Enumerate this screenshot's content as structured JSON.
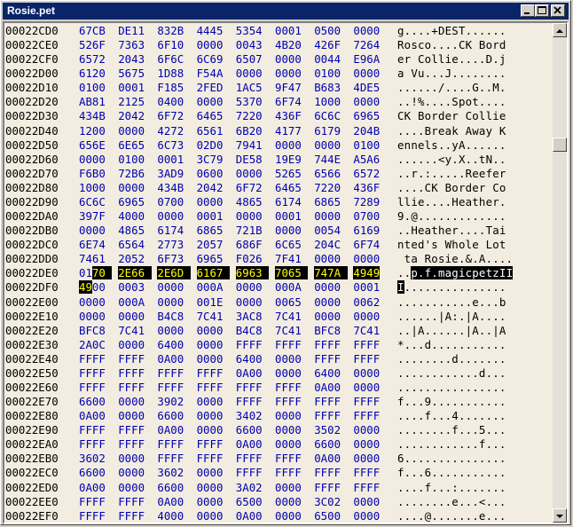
{
  "window": {
    "title": "Rosie.pet"
  },
  "rows": [
    {
      "addr": "00022CD0",
      "hex": [
        "67CB",
        "DE11",
        "832B",
        "4445",
        "5354",
        "0001",
        "0500",
        "0000"
      ],
      "ascii": "g....+DEST......"
    },
    {
      "addr": "00022CE0",
      "hex": [
        "526F",
        "7363",
        "6F10",
        "0000",
        "0043",
        "4B20",
        "426F",
        "7264"
      ],
      "ascii": "Rosco....CK Bord"
    },
    {
      "addr": "00022CF0",
      "hex": [
        "6572",
        "2043",
        "6F6C",
        "6C69",
        "6507",
        "0000",
        "0044",
        "E96A"
      ],
      "ascii": "er Collie....D.j"
    },
    {
      "addr": "00022D00",
      "hex": [
        "6120",
        "5675",
        "1D88",
        "F54A",
        "0000",
        "0000",
        "0100",
        "0000"
      ],
      "ascii": "a Vu...J........"
    },
    {
      "addr": "00022D10",
      "hex": [
        "0100",
        "0001",
        "F185",
        "2FED",
        "1AC5",
        "9F47",
        "B683",
        "4DE5"
      ],
      "ascii": "....../....G..M."
    },
    {
      "addr": "00022D20",
      "hex": [
        "AB81",
        "2125",
        "0400",
        "0000",
        "5370",
        "6F74",
        "1000",
        "0000"
      ],
      "ascii": "..!%....Spot...."
    },
    {
      "addr": "00022D30",
      "hex": [
        "434B",
        "2042",
        "6F72",
        "6465",
        "7220",
        "436F",
        "6C6C",
        "6965"
      ],
      "ascii": "CK Border Collie"
    },
    {
      "addr": "00022D40",
      "hex": [
        "1200",
        "0000",
        "4272",
        "6561",
        "6B20",
        "4177",
        "6179",
        "204B"
      ],
      "ascii": "....Break Away K"
    },
    {
      "addr": "00022D50",
      "hex": [
        "656E",
        "6E65",
        "6C73",
        "02D0",
        "7941",
        "0000",
        "0000",
        "0100"
      ],
      "ascii": "ennels..yA......"
    },
    {
      "addr": "00022D60",
      "hex": [
        "0000",
        "0100",
        "0001",
        "3C79",
        "DE58",
        "19E9",
        "744E",
        "A5A6"
      ],
      "ascii": "......<y.X..tN.."
    },
    {
      "addr": "00022D70",
      "hex": [
        "F6B0",
        "72B6",
        "3AD9",
        "0600",
        "0000",
        "5265",
        "6566",
        "6572"
      ],
      "ascii": "..r.:.....Reefer"
    },
    {
      "addr": "00022D80",
      "hex": [
        "1000",
        "0000",
        "434B",
        "2042",
        "6F72",
        "6465",
        "7220",
        "436F"
      ],
      "ascii": "....CK Border Co"
    },
    {
      "addr": "00022D90",
      "hex": [
        "6C6C",
        "6965",
        "0700",
        "0000",
        "4865",
        "6174",
        "6865",
        "7289"
      ],
      "ascii": "llie....Heather."
    },
    {
      "addr": "00022DA0",
      "hex": [
        "397F",
        "4000",
        "0000",
        "0001",
        "0000",
        "0001",
        "0000",
        "0700"
      ],
      "ascii": "9.@............."
    },
    {
      "addr": "00022DB0",
      "hex": [
        "0000",
        "4865",
        "6174",
        "6865",
        "721B",
        "0000",
        "0054",
        "6169"
      ],
      "ascii": "..Heather....Tai"
    },
    {
      "addr": "00022DC0",
      "hex": [
        "6E74",
        "6564",
        "2773",
        "2057",
        "686F",
        "6C65",
        "204C",
        "6F74"
      ],
      "ascii": "nted's Whole Lot"
    },
    {
      "addr": "00022DD0",
      "hex": [
        "7461",
        "2052",
        "6F73",
        "6965",
        "F026",
        "7F41",
        "0000",
        "0000"
      ],
      "ascii": " ta Rosie.&.A...."
    },
    {
      "addr": "00022DE0",
      "hex": [
        "0170",
        "2E66",
        "2E6D",
        "6167",
        "6963",
        "7065",
        "747A",
        "4949"
      ],
      "ascii": "..p.f.magicpetzII"
    },
    {
      "addr": "00022DF0",
      "hex": [
        "4900",
        "0003",
        "0000",
        "000A",
        "0000",
        "000A",
        "0000",
        "0001"
      ],
      "ascii": "I..............."
    },
    {
      "addr": "00022E00",
      "hex": [
        "0000",
        "000A",
        "0000",
        "001E",
        "0000",
        "0065",
        "0000",
        "0062"
      ],
      "ascii": "...........e...b"
    },
    {
      "addr": "00022E10",
      "hex": [
        "0000",
        "0000",
        "B4C8",
        "7C41",
        "3AC8",
        "7C41",
        "0000",
        "0000"
      ],
      "ascii": "......|A:.|A...."
    },
    {
      "addr": "00022E20",
      "hex": [
        "BFC8",
        "7C41",
        "0000",
        "0000",
        "B4C8",
        "7C41",
        "BFC8",
        "7C41"
      ],
      "ascii": "..|A......|A..|A"
    },
    {
      "addr": "00022E30",
      "hex": [
        "2A0C",
        "0000",
        "6400",
        "0000",
        "FFFF",
        "FFFF",
        "FFFF",
        "FFFF"
      ],
      "ascii": "*...d..........."
    },
    {
      "addr": "00022E40",
      "hex": [
        "FFFF",
        "FFFF",
        "0A00",
        "0000",
        "6400",
        "0000",
        "FFFF",
        "FFFF"
      ],
      "ascii": "........d......."
    },
    {
      "addr": "00022E50",
      "hex": [
        "FFFF",
        "FFFF",
        "FFFF",
        "FFFF",
        "0A00",
        "0000",
        "6400",
        "0000"
      ],
      "ascii": "............d..."
    },
    {
      "addr": "00022E60",
      "hex": [
        "FFFF",
        "FFFF",
        "FFFF",
        "FFFF",
        "FFFF",
        "FFFF",
        "0A00",
        "0000"
      ],
      "ascii": "................"
    },
    {
      "addr": "00022E70",
      "hex": [
        "6600",
        "0000",
        "3902",
        "0000",
        "FFFF",
        "FFFF",
        "FFFF",
        "FFFF"
      ],
      "ascii": "f...9..........."
    },
    {
      "addr": "00022E80",
      "hex": [
        "0A00",
        "0000",
        "6600",
        "0000",
        "3402",
        "0000",
        "FFFF",
        "FFFF"
      ],
      "ascii": "....f...4......."
    },
    {
      "addr": "00022E90",
      "hex": [
        "FFFF",
        "FFFF",
        "0A00",
        "0000",
        "6600",
        "0000",
        "3502",
        "0000"
      ],
      "ascii": "........f...5..."
    },
    {
      "addr": "00022EA0",
      "hex": [
        "FFFF",
        "FFFF",
        "FFFF",
        "FFFF",
        "0A00",
        "0000",
        "6600",
        "0000"
      ],
      "ascii": "............f..."
    },
    {
      "addr": "00022EB0",
      "hex": [
        "3602",
        "0000",
        "FFFF",
        "FFFF",
        "FFFF",
        "FFFF",
        "0A00",
        "0000"
      ],
      "ascii": "6..............."
    },
    {
      "addr": "00022EC0",
      "hex": [
        "6600",
        "0000",
        "3602",
        "0000",
        "FFFF",
        "FFFF",
        "FFFF",
        "FFFF"
      ],
      "ascii": "f...6..........."
    },
    {
      "addr": "00022ED0",
      "hex": [
        "0A00",
        "0000",
        "6600",
        "0000",
        "3A02",
        "0000",
        "FFFF",
        "FFFF"
      ],
      "ascii": "....f...:......."
    },
    {
      "addr": "00022EE0",
      "hex": [
        "FFFF",
        "FFFF",
        "0A00",
        "0000",
        "6500",
        "0000",
        "3C02",
        "0000"
      ],
      "ascii": "........e...<..."
    },
    {
      "addr": "00022EF0",
      "hex": [
        "FFFF",
        "FFFF",
        "4000",
        "0000",
        "0A00",
        "0000",
        "6500",
        "0000"
      ],
      "ascii": "....@.......e..."
    }
  ],
  "selection": {
    "hex": {
      "row": 17,
      "from_char": 2,
      "to_row": 18,
      "to_char": 2
    },
    "ascii": {
      "row": 17,
      "from_char": 2,
      "to_row": 18,
      "to_char": 1
    }
  },
  "scrollbar": {
    "position_fraction": 0.22
  },
  "colors": {
    "title_bg": "#0a246a",
    "hex_text": "#0000b0",
    "view_bg": "#f2ede0",
    "selection_bg": "#000000",
    "selection_hex_text": "#ffff00"
  },
  "icons": {
    "minimize": "minimize-icon",
    "maximize": "maximize-icon",
    "close": "close-icon",
    "scroll_up": "arrow-up-icon",
    "scroll_down": "arrow-down-icon"
  }
}
